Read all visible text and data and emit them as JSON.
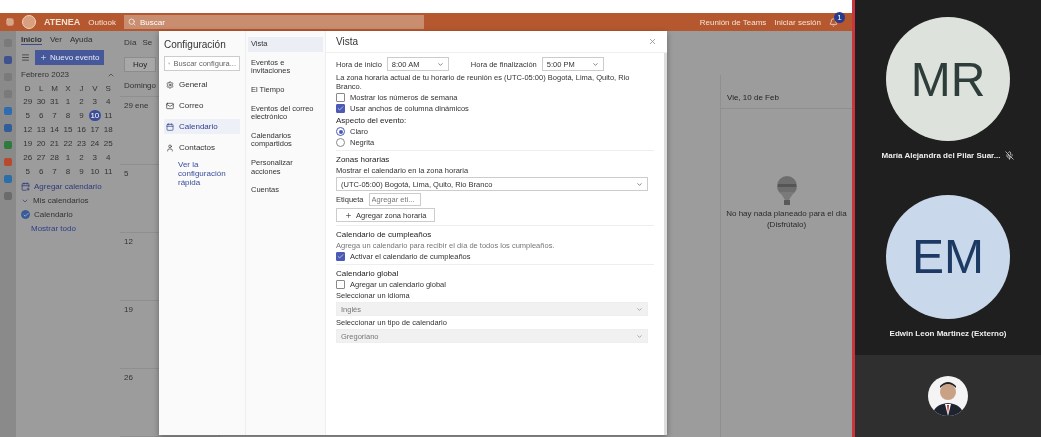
{
  "outlook": {
    "brand": "ATENEA",
    "app": "Outlook",
    "search": {
      "placeholder": "Buscar"
    },
    "header_right": [
      {
        "label": "Reunión de Teams"
      },
      {
        "label": "Iniciar sesión"
      }
    ],
    "notification_count": "1",
    "ribbon_tabs": [
      {
        "label": "Inicio",
        "selected": true
      },
      {
        "label": "Ver",
        "selected": false
      },
      {
        "label": "Ayuda",
        "selected": false
      }
    ],
    "new_event": "Nuevo evento",
    "view_buttons": [
      "Día",
      "Se"
    ],
    "today": "Hoy",
    "mini_calendar": {
      "title": "Febrero 2023",
      "weekdays": [
        "D",
        "L",
        "M",
        "X",
        "J",
        "V",
        "S"
      ],
      "weeks": [
        [
          {
            "label": "29",
            "selected": false
          },
          {
            "label": "30",
            "selected": false
          },
          {
            "label": "31",
            "selected": false
          },
          {
            "label": "1",
            "selected": false
          },
          {
            "label": "2",
            "selected": false
          },
          {
            "label": "3",
            "selected": false
          },
          {
            "label": "4",
            "selected": false
          }
        ],
        [
          {
            "label": "5",
            "selected": false
          },
          {
            "label": "6",
            "selected": false
          },
          {
            "label": "7",
            "selected": false
          },
          {
            "label": "8",
            "selected": false
          },
          {
            "label": "9",
            "selected": false
          },
          {
            "label": "10",
            "selected": true
          },
          {
            "label": "11",
            "selected": false
          }
        ],
        [
          {
            "label": "12",
            "selected": false
          },
          {
            "label": "13",
            "selected": false
          },
          {
            "label": "14",
            "selected": false
          },
          {
            "label": "15",
            "selected": false
          },
          {
            "label": "16",
            "selected": false
          },
          {
            "label": "17",
            "selected": false
          },
          {
            "label": "18",
            "selected": false
          }
        ],
        [
          {
            "label": "19",
            "selected": false
          },
          {
            "label": "20",
            "selected": false
          },
          {
            "label": "21",
            "selected": false
          },
          {
            "label": "22",
            "selected": false
          },
          {
            "label": "23",
            "selected": false
          },
          {
            "label": "24",
            "selected": false
          },
          {
            "label": "25",
            "selected": false
          }
        ],
        [
          {
            "label": "26",
            "selected": false
          },
          {
            "label": "27",
            "selected": false
          },
          {
            "label": "28",
            "selected": false
          },
          {
            "label": "1",
            "selected": false
          },
          {
            "label": "2",
            "selected": false
          },
          {
            "label": "3",
            "selected": false
          },
          {
            "label": "4",
            "selected": false
          }
        ],
        [
          {
            "label": "5",
            "selected": false
          },
          {
            "label": "6",
            "selected": false
          },
          {
            "label": "7",
            "selected": false
          },
          {
            "label": "8",
            "selected": false
          },
          {
            "label": "9",
            "selected": false
          },
          {
            "label": "10",
            "selected": false
          },
          {
            "label": "11",
            "selected": false
          }
        ]
      ]
    },
    "add_calendar": "Agregar calendario",
    "my_calendars": "Mis calendarios",
    "calendars": [
      {
        "label": "Calendario",
        "checked": true
      }
    ],
    "show_all": "Mostrar todo",
    "week_header": "Domingo",
    "week_cells": [
      "29 ene",
      "5",
      "12",
      "19",
      "26"
    ],
    "day_pane": {
      "title": "Vie, 10 de Feb",
      "empty": "No hay nada planeado para el día",
      "empty_sub": "(Disfrútalo)"
    }
  },
  "settings": {
    "title": "Configuración",
    "search": {
      "placeholder": "Buscar configura..."
    },
    "nav": [
      {
        "label": "General",
        "selected": false
      },
      {
        "label": "Correo",
        "selected": false
      },
      {
        "label": "Calendario",
        "selected": true
      },
      {
        "label": "Contactos",
        "selected": false
      }
    ],
    "quick_link": "Ver la configuración rápida",
    "subnav": [
      {
        "label": "Vista",
        "selected": true
      },
      {
        "label": "Eventos e invitaciones",
        "selected": false
      },
      {
        "label": "El Tiempo",
        "selected": false
      },
      {
        "label": "Eventos del correo electrónico",
        "selected": false
      },
      {
        "label": "Calendarios compartidos",
        "selected": false
      },
      {
        "label": "Personalizar acciones",
        "selected": false
      },
      {
        "label": "Cuentas",
        "selected": false
      }
    ],
    "pane_title": "Vista",
    "start_label": "Hora de inicio",
    "start_value": "8:00 AM",
    "end_label": "Hora de finalización",
    "end_value": "5:00 PM",
    "timezone_note": "La zona horaria actual de tu horario de reunión es (UTC-05:00) Bogotá, Lima, Quito, Rio Branco.",
    "options": [
      {
        "label": "Mostrar los números de semana",
        "checked": false
      },
      {
        "label": "Usar anchos de columna dinámicos",
        "checked": true
      }
    ],
    "appearance_label": "Aspecto del evento:",
    "appearance": [
      {
        "label": "Claro",
        "selected": true
      },
      {
        "label": "Negrita",
        "selected": false
      }
    ],
    "tz_heading": "Zonas horarias",
    "tz_label": "Mostrar el calendario en la zona horaria",
    "tz_value": "(UTC-05:00) Bogotá, Lima, Quito, Rio Branco",
    "tag_label": "Etiqueta",
    "tag_placeholder": "Agregar eti...",
    "add_tz": "Agregar zona horaria",
    "birthday_heading": "Calendario de cumpleaños",
    "birthday_note": "Agrega un calendario para recibir el día de todos los cumpleaños.",
    "birthday_option": {
      "label": "Activar el calendario de cumpleaños",
      "checked": true
    },
    "global_heading": "Calendario global",
    "global_option": {
      "label": "Agregar un calendario global",
      "checked": false
    },
    "language_label": "Seleccionar un idioma",
    "language_value": "Inglés",
    "language_disabled": true,
    "type_label": "Seleccionar un tipo de calendario",
    "type_value": "Gregoriano",
    "type_disabled": true
  },
  "participants": [
    {
      "kind": "initials",
      "initials": "MR",
      "name": "María Alejandra del Pilar Suar...",
      "muted": true
    },
    {
      "kind": "initials",
      "initials": "EM",
      "name": "Edwin Leon Martinez (Externo)",
      "muted": false
    },
    {
      "kind": "picture"
    }
  ]
}
